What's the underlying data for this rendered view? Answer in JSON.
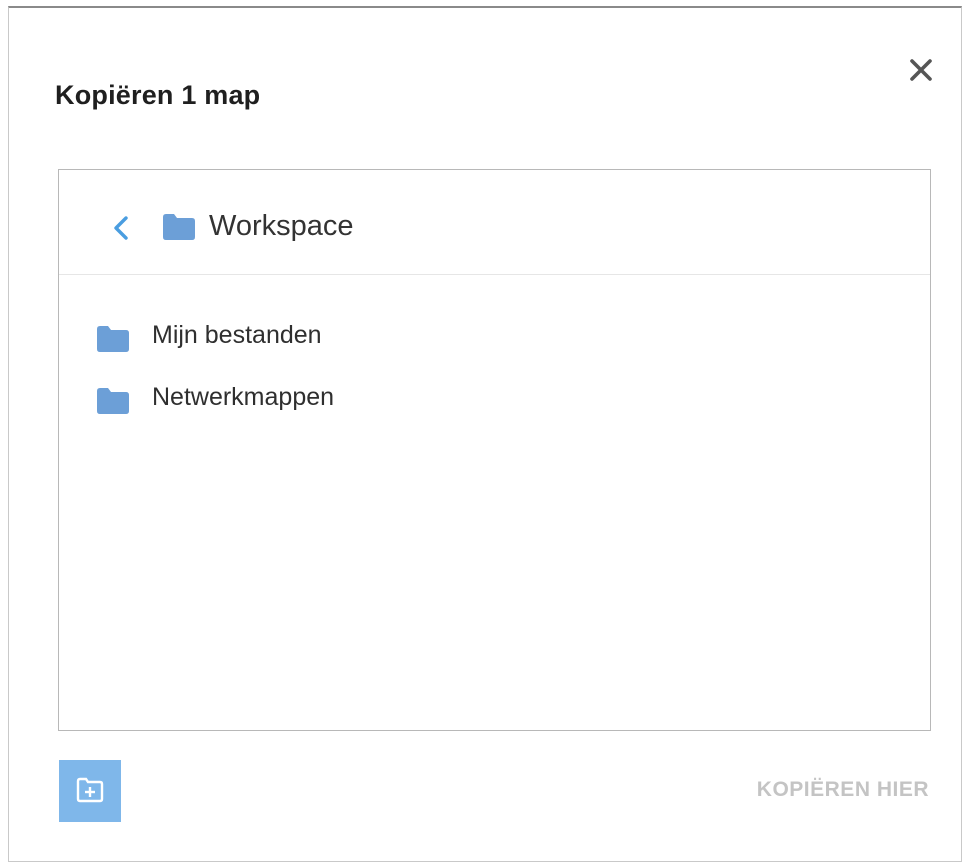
{
  "dialog": {
    "title": "Kopiëren 1 map",
    "close_icon": "close-icon"
  },
  "browser": {
    "current_folder": "Workspace",
    "back_icon": "chevron-left-icon",
    "folder_icon": "folder-icon",
    "items": [
      {
        "label": "Mijn bestanden",
        "icon": "folder-icon"
      },
      {
        "label": "Netwerkmappen",
        "icon": "folder-icon"
      }
    ]
  },
  "footer": {
    "new_folder_icon": "new-folder-icon",
    "copy_here_label": "KOPIËREN HIER",
    "copy_here_enabled": false
  },
  "colors": {
    "accent": "#7fb7ea",
    "folder": "#6c9fd7",
    "chevron": "#4a9de0",
    "disabled_text": "#c4c4c4"
  }
}
